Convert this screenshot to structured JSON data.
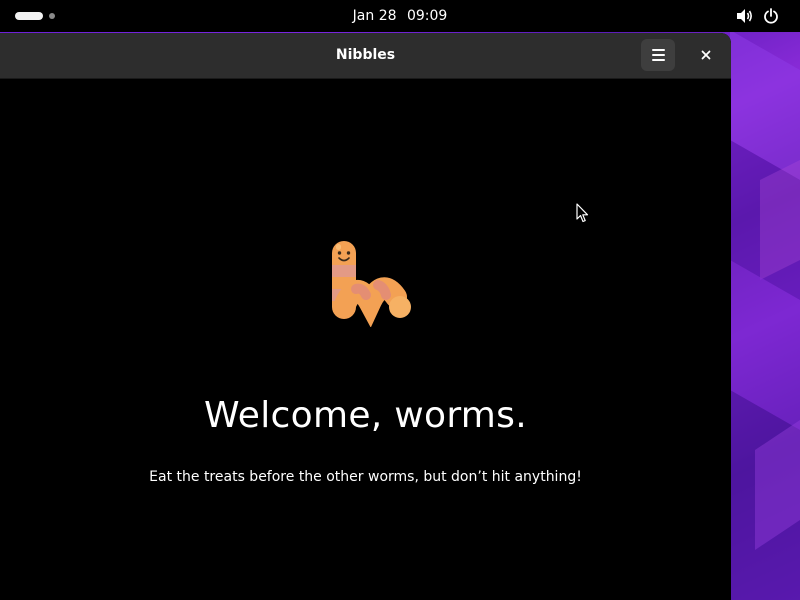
{
  "topbar": {
    "date": "Jan 28",
    "time": "09:09",
    "icons": [
      "volume-icon",
      "power-icon"
    ]
  },
  "window": {
    "title": "Nibbles",
    "menu_icon": "hamburger-menu-icon",
    "close_icon": "close-icon"
  },
  "welcome": {
    "logo_icon": "worm-logo-icon",
    "heading": "Welcome, worms.",
    "subtitle": "Eat the treats before the other worms, but don’t hit anything!"
  },
  "colors": {
    "topbar_bg": "#000000",
    "headerbar_bg": "#2d2d2d",
    "content_bg": "#000000",
    "wallpaper_accent": "#6a1fd6",
    "worm_orange": "#f4a35a",
    "worm_pink": "#e29a8e"
  }
}
